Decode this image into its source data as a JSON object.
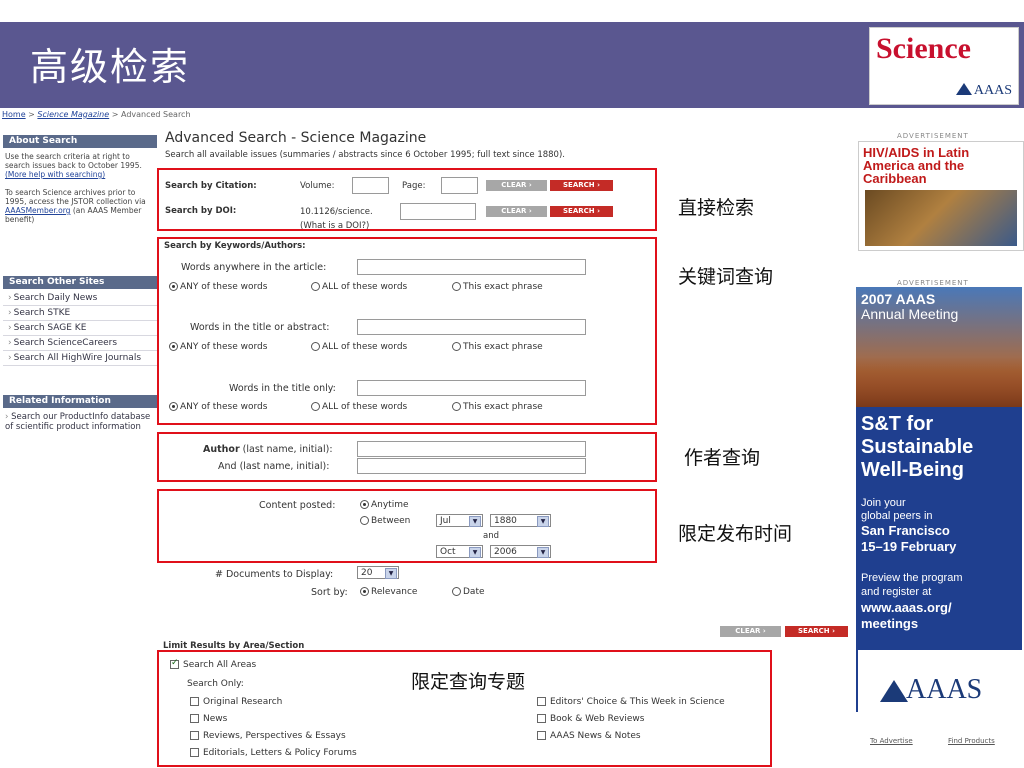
{
  "header": {
    "title": "高级检索",
    "logo_text": "Science",
    "logo_sub": "AAAS"
  },
  "breadcrumb": {
    "home": "Home",
    "sep1": " > ",
    "magazine": "Science Magazine",
    "sep2": " > ",
    "current": "Advanced Search"
  },
  "sidebar": {
    "about": {
      "heading": "About Search",
      "text1": "Use the search criteria at right to search issues back to October 1995.",
      "link1": "(More help with searching)",
      "text2": "To search Science archives prior to 1995, access the JSTOR collection via",
      "link2": "AAASMember.org",
      "text3": "(an AAAS Member benefit)"
    },
    "other_sites": {
      "heading": "Search Other Sites",
      "items": [
        "Search Daily News",
        "Search STKE",
        "Search SAGE KE",
        "Search ScienceCareers",
        "Search All HighWire Journals"
      ]
    },
    "related": {
      "heading": "Related Information",
      "text": "Search our ProductInfo database of scientific product information"
    }
  },
  "main": {
    "title": "Advanced Search - Science Magazine",
    "subtitle": "Search all available issues (summaries / abstracts since 6 October 1995; full text since 1880).",
    "citation": {
      "label": "Search by Citation:",
      "volume_label": "Volume:",
      "page_label": "Page:"
    },
    "doi": {
      "label": "Search by DOI:",
      "prefix": "10.1126/science.",
      "what_link": "(What is a DOI?)"
    },
    "buttons": {
      "clear": "CLEAR ›",
      "search": "SEARCH ›"
    },
    "keywords": {
      "heading": "Search by Keywords/Authors:",
      "anywhere_label": "Words anywhere in the article:",
      "title_abstract_label": "Words in the title or abstract:",
      "title_only_label": "Words in the title only:",
      "opt_any": "ANY of these words",
      "opt_all": "ALL of these words",
      "opt_exact": "This exact phrase"
    },
    "author": {
      "label_bold": "Author",
      "label_rest": " (last name, initial):",
      "and_label": "And (last name, initial):"
    },
    "content": {
      "label": "Content posted:",
      "anytime": "Anytime",
      "between": "Between",
      "from_month": "Jul",
      "from_year": "1880",
      "and": "and",
      "to_month": "Oct",
      "to_year": "2006"
    },
    "docs_label": "# Documents to Display:",
    "docs_value": "20",
    "sort_label": "Sort by:",
    "sort_relevance": "Relevance",
    "sort_date": "Date",
    "limit": {
      "heading": "Limit Results by Area/Section",
      "all_areas": "Search All Areas",
      "search_only": "Search Only:",
      "left": [
        "Original Research",
        "News",
        "Reviews, Perspectives & Essays",
        "Editorials, Letters & Policy Forums"
      ],
      "right": [
        "Editors' Choice & This Week in Science",
        "Book & Web Reviews",
        "AAAS News & Notes"
      ]
    }
  },
  "annotations": {
    "direct": "直接检索",
    "keyword": "关键词查询",
    "author": "作者查询",
    "date": "限定发布时间",
    "topic": "限定查询专题"
  },
  "ads": {
    "label": "ADVERTISEMENT",
    "ad1_title": "HIV/AIDS in Latin America and the Caribbean",
    "ad2_year": "2007 AAAS",
    "ad2_meeting": "Annual Meeting",
    "ad2_h1": "S&T for",
    "ad2_h2": "Sustainable",
    "ad2_h3": "Well-Being",
    "ad2_p1": "Join your",
    "ad2_p2": "global peers in",
    "ad2_city": "San Francisco",
    "ad2_dates": "15–19 February",
    "ad2_p3": "Preview the program",
    "ad2_p4": "and register at",
    "ad2_url1": "www.aaas.org/",
    "ad2_url2": "meetings",
    "aaas": "AAAS",
    "advertise": "To Advertise",
    "find_products": "Find Products"
  },
  "colors": {
    "header_bg": "#5a5790",
    "annotation_red": "#e0101a",
    "search_btn": "#c42b26"
  }
}
